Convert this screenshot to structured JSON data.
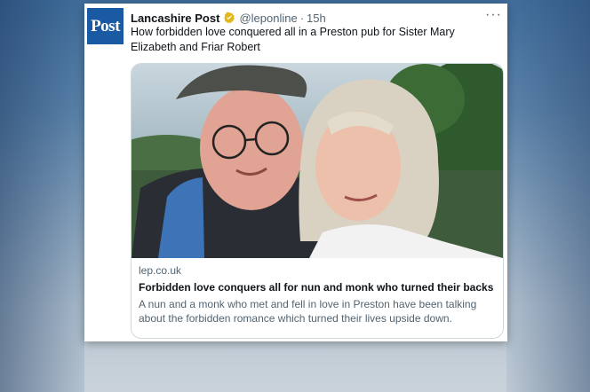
{
  "account": {
    "avatar_text": "Post",
    "display_name": "Lancashire Post",
    "handle": "@leponline",
    "separator": "·",
    "time": "15h",
    "more_label": "···"
  },
  "tweet": {
    "text": "How forbidden love conquered all in a Preston pub for Sister Mary Elizabeth and Friar Robert"
  },
  "link_card": {
    "domain": "lep.co.uk",
    "title": "Forbidden love conquers all for nun and monk who turned their backs ...",
    "description": "A nun and a monk who met and fell in love in Preston have been talking about the forbidden romance which turned their lives upside down."
  },
  "colors": {
    "avatar_bg": "#1a5aa3",
    "verified_badge": "#e2b719",
    "secondary_text": "#536471",
    "card_border": "#cfd9de"
  },
  "icons": [
    "verified-badge-icon",
    "more-options-icon"
  ]
}
